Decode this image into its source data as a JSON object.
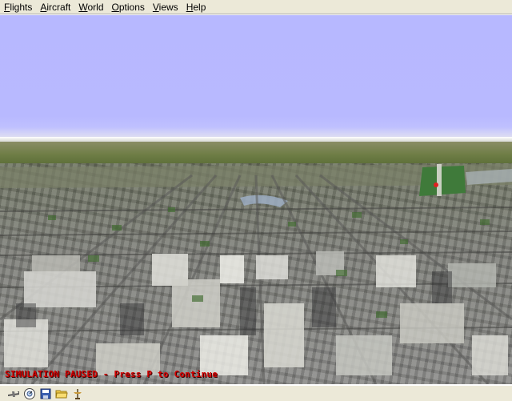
{
  "menu": {
    "items": [
      {
        "label": "Flights",
        "accel": "F",
        "rest": "lights"
      },
      {
        "label": "Aircraft",
        "accel": "A",
        "rest": "ircraft"
      },
      {
        "label": "World",
        "accel": "W",
        "rest": "orld"
      },
      {
        "label": "Options",
        "accel": "O",
        "rest": "ptions"
      },
      {
        "label": "Views",
        "accel": "V",
        "rest": "iews"
      },
      {
        "label": "Help",
        "accel": "H",
        "rest": "elp"
      }
    ]
  },
  "status": {
    "message": "SIMULATION PAUSED - Press P to Continue",
    "color": "#d40000"
  },
  "toolbar": {
    "buttons": [
      {
        "icon": "aircraft-icon"
      },
      {
        "icon": "gauge-icon"
      },
      {
        "icon": "save-icon"
      },
      {
        "icon": "open-folder-icon"
      },
      {
        "icon": "weather-vane-icon"
      }
    ]
  },
  "colors": {
    "sky": "#b8b9ff",
    "menu_bg": "#ece9d8",
    "paused": "#d40000"
  }
}
